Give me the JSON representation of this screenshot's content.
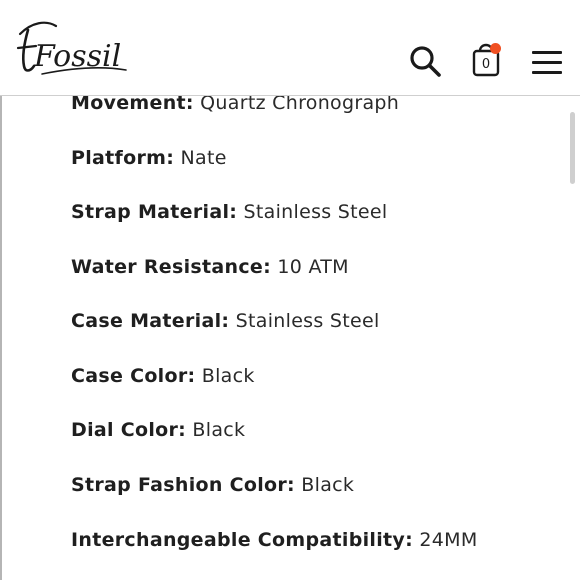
{
  "header": {
    "logo_text": "Fossil",
    "cart_count": "0",
    "accent_color": "#f05022",
    "icons": [
      "search-icon",
      "shopping-bag-icon",
      "hamburger-menu-icon"
    ]
  },
  "specs": [
    {
      "label": "Movement:",
      "value": "Quartz Chronograph"
    },
    {
      "label": "Platform:",
      "value": "Nate"
    },
    {
      "label": "Strap Material:",
      "value": "Stainless Steel"
    },
    {
      "label": "Water Resistance:",
      "value": "10 ATM"
    },
    {
      "label": "Case Material:",
      "value": "Stainless Steel"
    },
    {
      "label": "Case Color:",
      "value": "Black"
    },
    {
      "label": "Dial Color:",
      "value": "Black"
    },
    {
      "label": "Strap Fashion Color:",
      "value": "Black"
    },
    {
      "label": "Interchangeable Compatibility:",
      "value": "24MM"
    }
  ]
}
